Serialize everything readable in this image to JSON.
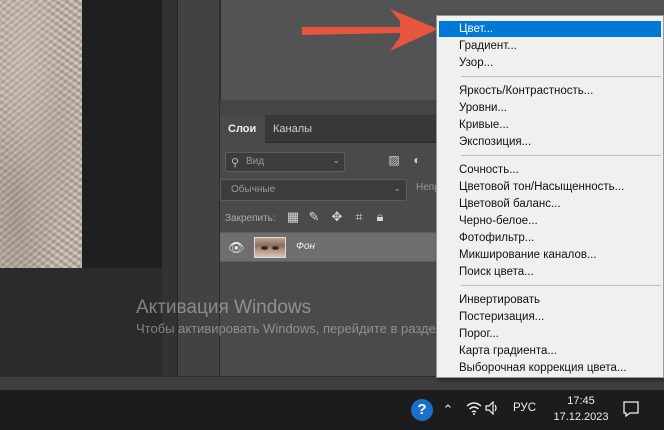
{
  "layers_panel": {
    "tabs": [
      {
        "label": "Слои"
      },
      {
        "label": "Каналы"
      }
    ],
    "filter_placeholder": "Вид",
    "blend_mode": "Обычные",
    "opacity_label": "Непр",
    "lock_label": "Закрепить:",
    "layer": {
      "name": "Фон"
    }
  },
  "adjustment_menu": {
    "items": [
      "Цвет...",
      "Градиент...",
      "Узор...",
      "Яркость/Контрастность...",
      "Уровни...",
      "Кривые...",
      "Экспозиция...",
      "Сочность...",
      "Цветовой тон/Насыщенность...",
      "Цветовой баланс...",
      "Черно-белое...",
      "Фотофильтр...",
      "Микширование каналов...",
      "Поиск цвета...",
      "Инвертировать",
      "Постеризация...",
      "Порог...",
      "Карта градиента...",
      "Выборочная коррекция цвета..."
    ],
    "selected_index": 0
  },
  "watermark": {
    "title": "Активация Windows",
    "subtitle": "Чтобы активировать Windows, перейдите в раздел \"Параметры\"."
  },
  "taskbar": {
    "help_glyph": "?",
    "language": "РУС",
    "time": "17:45",
    "date": "17.12.2023"
  },
  "colors": {
    "accent": "#0078d7",
    "arrow": "#e8553e"
  }
}
